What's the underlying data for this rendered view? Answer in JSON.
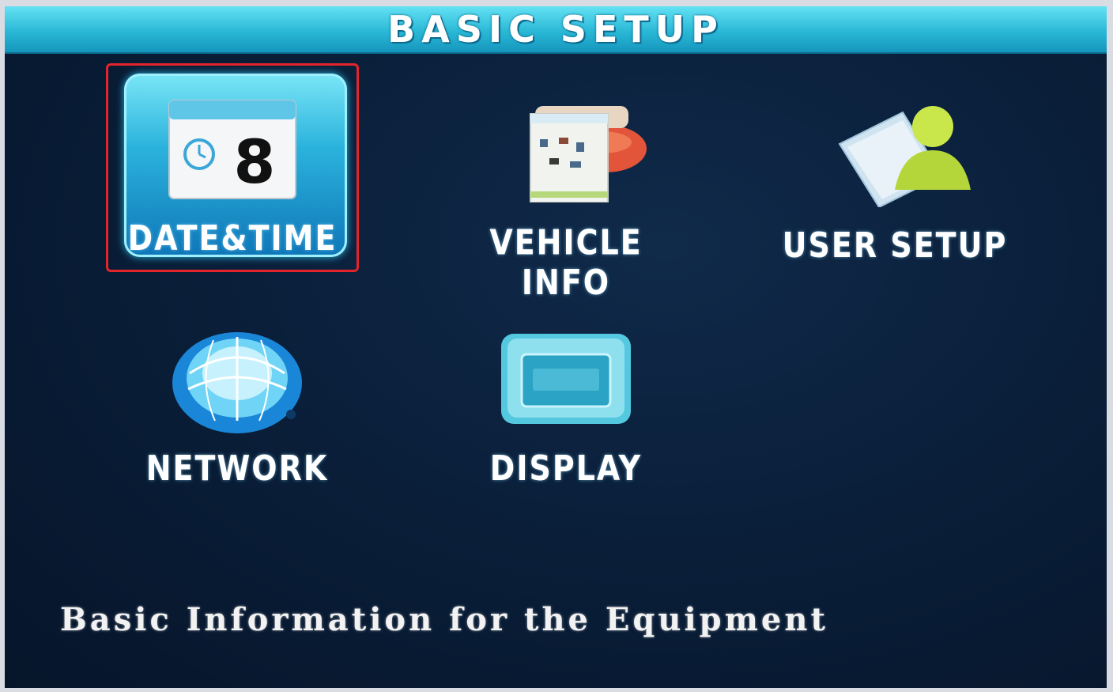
{
  "header": {
    "title": "BASIC SETUP"
  },
  "menu": {
    "items": [
      {
        "label": "DATE&TIME",
        "icon": "calendar-clock-icon",
        "selected": true,
        "calendar_day": "8"
      },
      {
        "label": "VEHICLE INFO",
        "icon": "vehicle-document-icon",
        "selected": false
      },
      {
        "label": "USER SETUP",
        "icon": "user-icon",
        "selected": false
      },
      {
        "label": "NETWORK",
        "icon": "globe-network-icon",
        "selected": false
      },
      {
        "label": "DISPLAY",
        "icon": "monitor-icon",
        "selected": false
      }
    ]
  },
  "footer": {
    "description": "Basic Information for the Equipment"
  },
  "colors": {
    "accent": "#2ab8d6",
    "selection_border": "#e3252b",
    "background": "#0a1f3a",
    "text": "#ffffff"
  }
}
